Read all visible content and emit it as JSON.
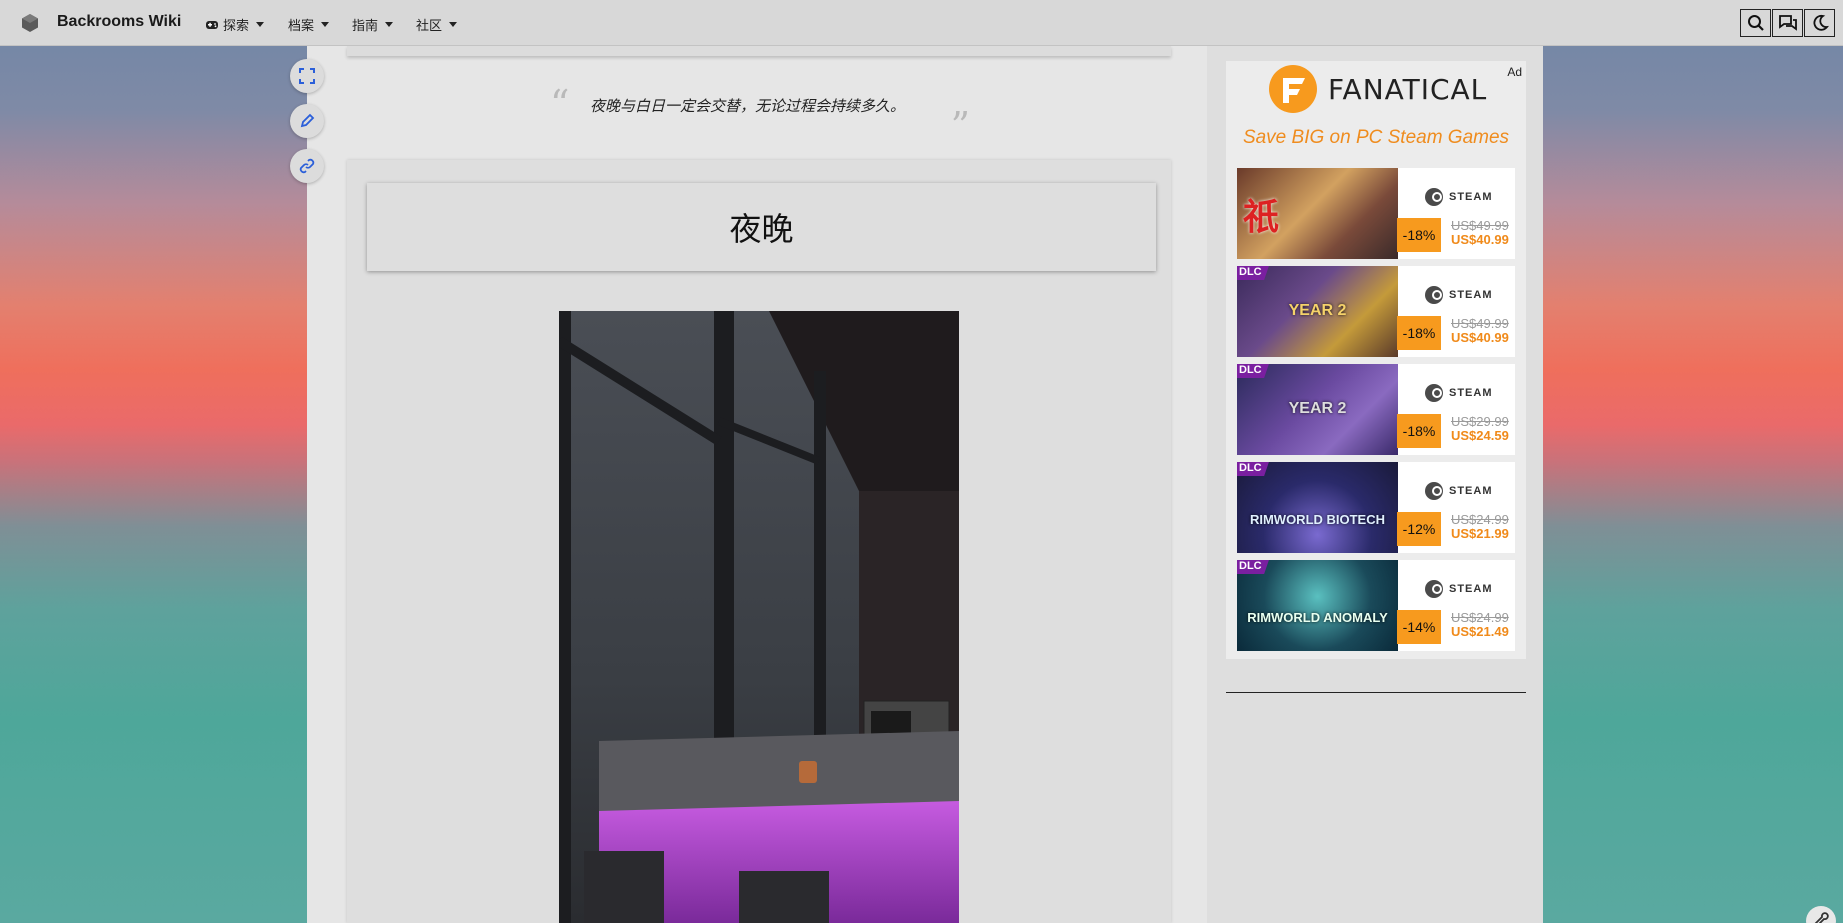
{
  "nav": {
    "site_title": "Backrooms Wiki",
    "items": [
      {
        "label": "探索",
        "icon": "gamepad-icon"
      },
      {
        "label": "档案"
      },
      {
        "label": "指南"
      },
      {
        "label": "社区"
      }
    ],
    "tools": [
      "search-icon",
      "discussion-icon",
      "dark-mode-icon"
    ]
  },
  "page": {
    "quote": "夜晚与白日一定会交替，无论过程会持续多久。",
    "quote_open": "“",
    "quote_close": "”",
    "title": "夜晚",
    "side_actions": [
      "fullscreen-icon",
      "edit-icon",
      "link-icon"
    ]
  },
  "ad": {
    "label": "Ad",
    "brand": "FANATICAL",
    "tagline": "Save BIG on PC Steam Games",
    "platform": "STEAM",
    "dlc_badge": "DLC",
    "deals": [
      {
        "image_text": "祇",
        "dlc": false,
        "discount": "-18%",
        "old_price": "US$49.99",
        "new_price": "US$40.99"
      },
      {
        "image_text": "YEAR 2",
        "dlc": true,
        "discount": "-18%",
        "old_price": "US$49.99",
        "new_price": "US$40.99"
      },
      {
        "image_text": "YEAR 2",
        "dlc": true,
        "discount": "-18%",
        "old_price": "US$29.99",
        "new_price": "US$24.59"
      },
      {
        "image_text": "RIMWORLD BIOTECH",
        "dlc": true,
        "discount": "-12%",
        "old_price": "US$24.99",
        "new_price": "US$21.99"
      },
      {
        "image_text": "RIMWORLD ANOMALY",
        "dlc": true,
        "discount": "-14%",
        "old_price": "US$24.99",
        "new_price": "US$21.49"
      }
    ]
  },
  "colors": {
    "accent": "#ef8c1e",
    "dlc": "#7a1fa0",
    "link": "#2b5fd9"
  }
}
